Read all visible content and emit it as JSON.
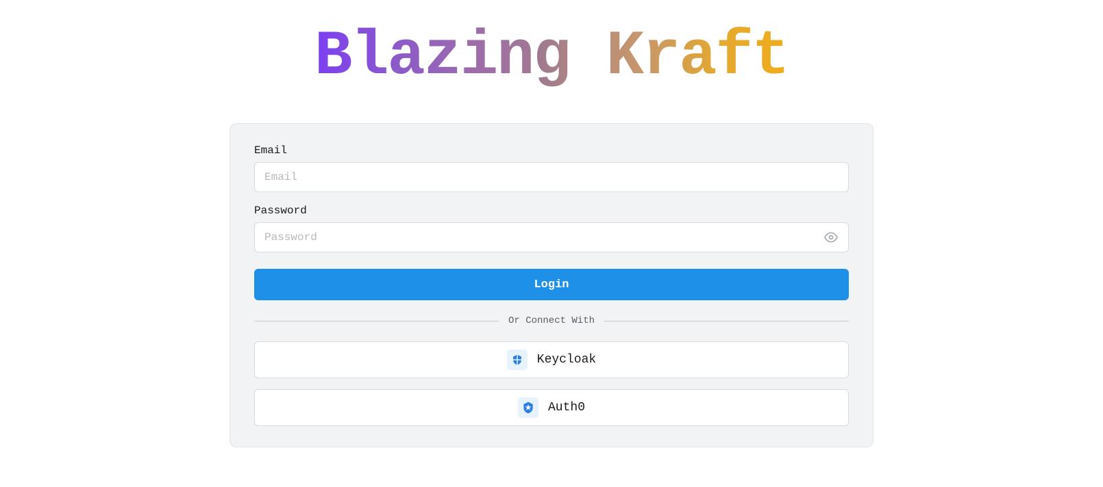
{
  "brand": {
    "title": "Blazing Kraft"
  },
  "login": {
    "email_label": "Email",
    "email_placeholder": "Email",
    "email_value": "",
    "password_label": "Password",
    "password_placeholder": "Password",
    "password_value": "",
    "login_button_label": "Login",
    "divider_text": "Or Connect With",
    "providers": [
      {
        "name": "Keycloak"
      },
      {
        "name": "Auth0"
      }
    ]
  },
  "colors": {
    "primary": "#1e90e8",
    "card_bg": "#f2f3f5",
    "border": "#d6d9de"
  }
}
